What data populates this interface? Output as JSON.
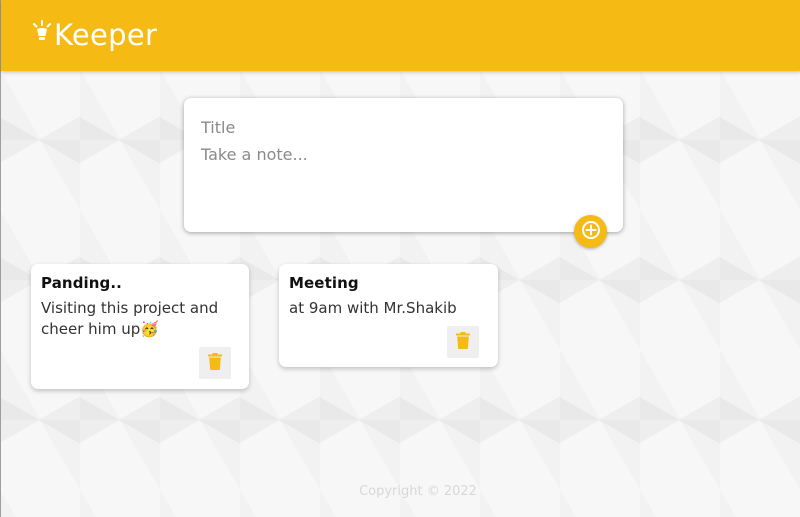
{
  "header": {
    "title": "Keeper",
    "logo_icon": "lightbulb-icon",
    "background": "#f5ba13"
  },
  "create_note": {
    "title_placeholder": "Title",
    "content_placeholder": "Take a note...",
    "add_icon": "plus-circle-icon"
  },
  "notes": [
    {
      "title": "Panding..",
      "content": "Visiting this project and cheer him up🥳",
      "delete_icon": "trash-icon"
    },
    {
      "title": "Meeting",
      "content": "at 9am with Mr.Shakib",
      "delete_icon": "trash-icon"
    }
  ],
  "footer": {
    "copyright": "Copyright © 2022"
  },
  "colors": {
    "accent": "#f5ba13",
    "footer_text": "#d8d8d8"
  }
}
